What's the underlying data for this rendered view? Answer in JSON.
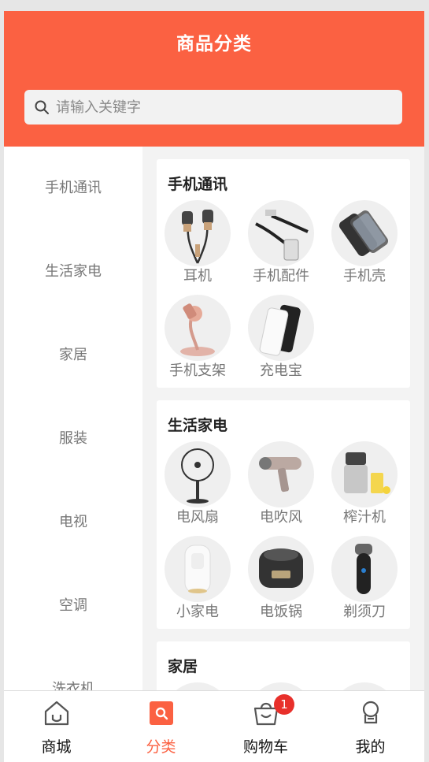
{
  "header": {
    "title": "商品分类"
  },
  "search": {
    "placeholder": "请输入关键字"
  },
  "sidebar": {
    "items": [
      "手机通讯",
      "生活家电",
      "家居",
      "服装",
      "电视",
      "空调",
      "洗衣机"
    ]
  },
  "sections": [
    {
      "title": "手机通讯",
      "items": [
        {
          "label": "耳机",
          "icon": "earphones-icon"
        },
        {
          "label": "手机配件",
          "icon": "cable-icon"
        },
        {
          "label": "手机壳",
          "icon": "phone-case-icon"
        },
        {
          "label": "手机支架",
          "icon": "phone-stand-icon"
        },
        {
          "label": "充电宝",
          "icon": "power-bank-icon"
        }
      ]
    },
    {
      "title": "生活家电",
      "items": [
        {
          "label": "电风扇",
          "icon": "fan-icon"
        },
        {
          "label": "电吹风",
          "icon": "hair-dryer-icon"
        },
        {
          "label": "榨汁机",
          "icon": "juicer-icon"
        },
        {
          "label": "小家电",
          "icon": "humidifier-icon"
        },
        {
          "label": "电饭锅",
          "icon": "rice-cooker-icon"
        },
        {
          "label": "剃须刀",
          "icon": "shaver-icon"
        }
      ]
    },
    {
      "title": "家居",
      "items": []
    }
  ],
  "tabbar": {
    "items": [
      {
        "label": "商城",
        "icon": "home-icon"
      },
      {
        "label": "分类",
        "icon": "category-icon",
        "active": true
      },
      {
        "label": "购物车",
        "icon": "cart-icon",
        "badge": "1"
      },
      {
        "label": "我的",
        "icon": "profile-icon"
      }
    ]
  },
  "colors": {
    "brand": "#fb6142",
    "badge": "#e8302b"
  }
}
